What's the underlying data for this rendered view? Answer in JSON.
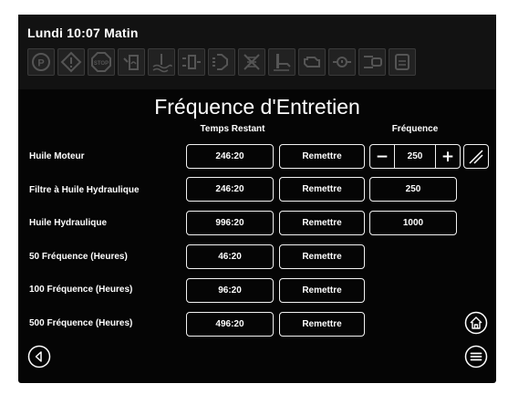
{
  "status": {
    "clock": "Lundi 10:07 Matin"
  },
  "warning_icons": [
    "parking-brake-icon",
    "warning-icon",
    "stop-icon",
    "fuel-level-icon",
    "coolant-temperature-icon",
    "battery-charge-icon",
    "preheat-icon",
    "air-filter-icon",
    "hydraulic-oil-level-icon",
    "engine-check-icon",
    "oil-pressure-icon",
    "hydraulic-filter-icon",
    "maintenance-icon"
  ],
  "page": {
    "title": "Fréquence d'Entretien"
  },
  "columns": {
    "remaining": "Temps Restant",
    "frequency": "Fréquence"
  },
  "rows": [
    {
      "label": "Huile Moteur",
      "remaining": "246:20",
      "reset": "Remettre",
      "frequency": "250"
    },
    {
      "label": "Filtre à Huile Hydraulique",
      "remaining": "246:20",
      "reset": "Remettre",
      "frequency": "250"
    },
    {
      "label": "Huile Hydraulique",
      "remaining": "996:20",
      "reset": "Remettre",
      "frequency": "1000"
    },
    {
      "label": "50 Fréquence (Heures)",
      "remaining": "46:20",
      "reset": "Remettre"
    },
    {
      "label": "100 Fréquence (Heures)",
      "remaining": "96:20",
      "reset": "Remettre"
    },
    {
      "label": "500 Fréquence (Heures)",
      "remaining": "496:20",
      "reset": "Remettre"
    }
  ],
  "stepper": {
    "minus": "−",
    "plus": "+"
  },
  "nav": {
    "back_icon": "back-icon",
    "home_icon": "home-icon",
    "menu_icon": "menu-icon",
    "edit_icon": "edit-icon"
  },
  "colors": {
    "background": "#050505",
    "topbar": "#121212",
    "outline": "#f2f2f2",
    "icon_inactive": "#555555"
  }
}
